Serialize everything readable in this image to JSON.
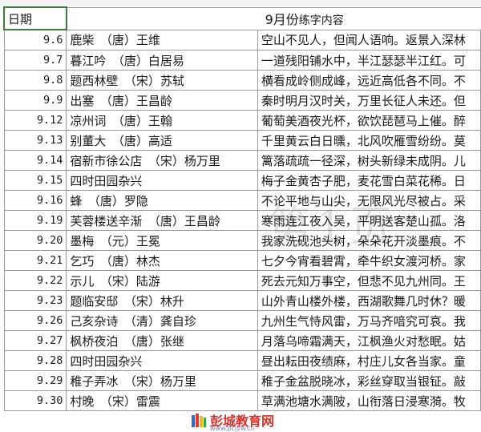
{
  "header": {
    "date_label": "日期",
    "month_title_prefix": "9月份",
    "month_title_suffix": "练字内容"
  },
  "rows": [
    {
      "date": "9.6",
      "title": "鹿柴　（唐）王维",
      "content": "空山不见人，但闻人语响。返景入深林"
    },
    {
      "date": "9.7",
      "title": "暮江吟　（唐）白居易",
      "content": "一道残阳铺水中，半江瑟瑟半江红。可"
    },
    {
      "date": "9.8",
      "title": "题西林壁　（宋）苏轼",
      "content": "横看成岭侧成峰，远近高低各不同。不"
    },
    {
      "date": "9.9",
      "title": "出塞　（唐）王昌龄",
      "content": "秦时明月汉时关，万里长征人未还。但"
    },
    {
      "date": "9.12",
      "title": "凉州词　（唐）王翰",
      "content": "葡萄美酒夜光杯，欲饮琵琶马上催。醉"
    },
    {
      "date": "9.13",
      "title": "别董大　（唐）高适",
      "content": "千里黄云白日曛，北风吹雁雪纷纷。莫"
    },
    {
      "date": "9.14",
      "title": "宿新市徐公店　（宋）杨万里",
      "content": "篱落疏疏一径深，树头新绿未成阴。儿"
    },
    {
      "date": "9.15",
      "title": "四时田园杂兴",
      "content": "梅子金黄杏子肥，麦花雪白菜花稀。日"
    },
    {
      "date": "9.16",
      "title": "蜂　（唐）罗隐",
      "content": "不论平地与山尖，无限风光尽被占。采"
    },
    {
      "date": "9.19",
      "title": "芙蓉楼送辛渐　（唐）王昌龄",
      "content": "寒雨连江夜入吴，平明送客楚山孤。洛"
    },
    {
      "date": "9.20",
      "title": "墨梅　（元）王冕",
      "content": "我家洗砚池头树，朵朵花开淡墨痕。不"
    },
    {
      "date": "9.21",
      "title": "乞巧　（唐）林杰",
      "content": "七夕今宵看碧霄，牵牛织女渡河桥。家"
    },
    {
      "date": "9.22",
      "title": "示儿　（宋）陆游",
      "content": "死去元知万事空，但悲不见九州同。王"
    },
    {
      "date": "9.23",
      "title": "题临安邸　（宋）林升",
      "content": "山外青山楼外楼，西湖歌舞几时休？暖"
    },
    {
      "date": "9.26",
      "title": "己亥杂诗　（清）龚自珍",
      "content": "九州生气恃风雷，万马齐喑究可哀。我"
    },
    {
      "date": "9.27",
      "title": "枫桥夜泊　（唐）张继",
      "content": "月落乌啼霜满天，江枫渔火对愁眠。姑"
    },
    {
      "date": "9.28",
      "title": "四时田园杂兴",
      "content": "昼出耘田夜绩麻，村庄儿女各当家。童"
    },
    {
      "date": "9.29",
      "title": "稚子弄冰　（宋）杨万里",
      "content": "稚子金盆脱晓冰，彩丝穿取当银钲。敲"
    },
    {
      "date": "9.30",
      "title": "村晚　（宋）雷震",
      "content": "草满池塘水满陂，山衔落日浸寒漪。牧"
    }
  ],
  "watermark_text": "第1页",
  "logo": {
    "name": "彭城教育网",
    "url": "www.pcjyw.cn"
  },
  "colors": {
    "grid": "#9a9a9a",
    "selected_cell_border": "#3b7a3b",
    "logo_red": "#d9342b"
  }
}
